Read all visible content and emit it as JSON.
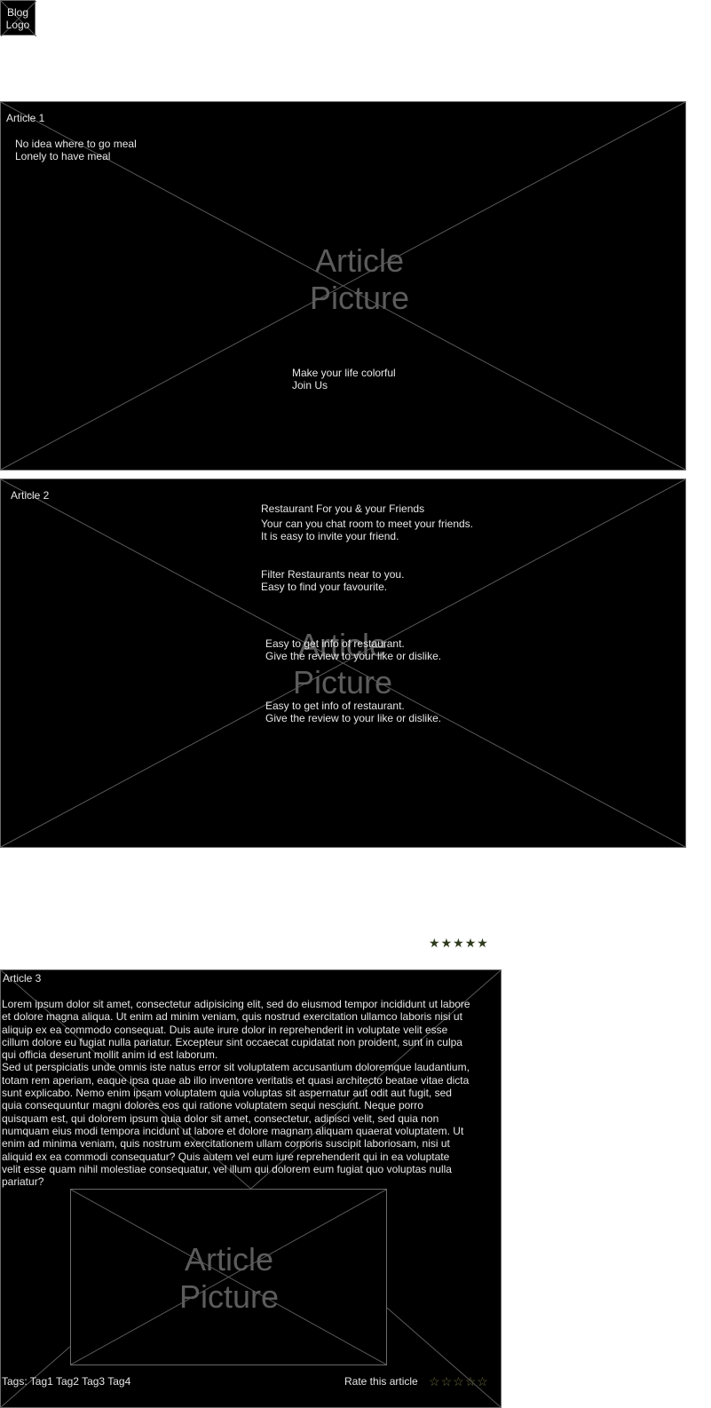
{
  "logo": {
    "text": "Blog Logo"
  },
  "placeholder_text": "Article Picture",
  "article1": {
    "title": "Article 1",
    "tagline_line1": "No idea where to go meal",
    "tagline_line2": "Lonely to have meal",
    "cta_line1": "Make your life colorful",
    "cta_line2": "Join Us"
  },
  "article2": {
    "title": "Article 2",
    "heading": "Restaurant For you & your Friends",
    "feature1_line1": "Your can you chat room  to meet your friends.",
    "feature1_line2": "It is easy to invite your friend.",
    "feature2_line1": "Filter Restaurants near to you.",
    "feature2_line2": "Easy to find your favourite.",
    "feature3_line1": "Easy to get info of restaurant.",
    "feature3_line2": "Give the review to your like or dislike.",
    "feature4_line1": "Easy to get info of restaurant.",
    "feature4_line2": "Give the review to your like or dislike."
  },
  "rating_top": {
    "stars": [
      "★",
      "★",
      "★",
      "★",
      "★"
    ],
    "value": 5,
    "max": 5,
    "color": "#2e3a1c"
  },
  "article3": {
    "title": "Article 3",
    "paragraph1": "Lorem ipsum dolor sit amet, consectetur adipisicing elit, sed do eiusmod tempor incididunt ut labore et dolore magna aliqua. Ut enim ad minim veniam, quis nostrud exercitation ullamco laboris nisi ut aliquip ex ea commodo consequat. Duis aute irure dolor in reprehenderit in voluptate velit esse cillum dolore eu fugiat nulla pariatur. Excepteur sint occaecat cupidatat non proident, sunt in culpa qui officia deserunt mollit anim id est laborum.",
    "paragraph2": "Sed ut perspiciatis unde omnis iste natus error sit voluptatem accusantium doloremque laudantium, totam rem aperiam, eaque ipsa quae ab illo inventore veritatis et quasi architecto beatae vitae dicta sunt explicabo. Nemo enim ipsam voluptatem quia voluptas sit aspernatur aut odit aut fugit, sed quia consequuntur magni dolores eos qui ratione voluptatem sequi nesciunt. Neque porro quisquam est, qui dolorem ipsum quia dolor sit amet, consectetur, adipisci velit, sed quia non numquam eius modi tempora incidunt ut labore et dolore magnam aliquam quaerat voluptatem. Ut enim ad minima veniam, quis nostrum exercitationem ullam corporis suscipit laboriosam, nisi ut aliquid ex ea commodi consequatur? Quis autem vel eum iure reprehenderit qui in ea voluptate velit esse quam nihil molestiae consequatur, vel illum qui dolorem eum fugiat quo voluptas nulla pariatur?",
    "tags_label": "Tags: Tag1 Tag2 Tag3 Tag4",
    "rate_label": "Rate this article",
    "rate_stars": [
      "☆",
      "☆",
      "☆",
      "☆",
      "☆"
    ],
    "rate_color": "#6b6b3a"
  },
  "colors": {
    "background": "#000000",
    "text": "#e6e6e6",
    "placeholder": "#5c5c5c",
    "lines": "#6a6a6a"
  }
}
